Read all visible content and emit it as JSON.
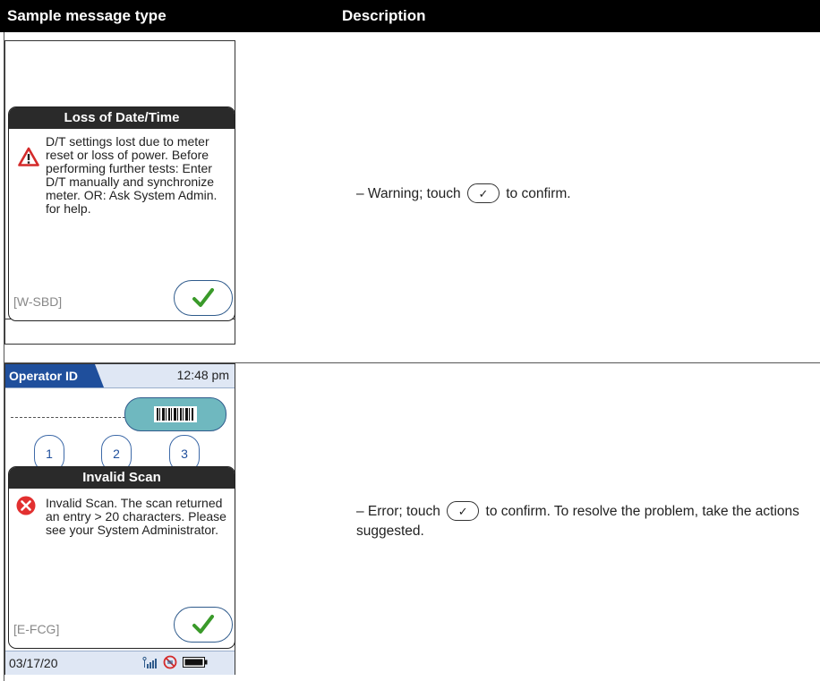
{
  "table": {
    "col1_header": "Sample message type",
    "col2_header": "Description"
  },
  "row1": {
    "dialog_title": "Loss of Date/Time",
    "message": "D/T settings lost due to meter reset or loss of power. Before performing further tests: Enter D/T manually and synchronize meter. OR: Ask System Admin. for help.",
    "code": "[W-SBD]",
    "icon": "warning-triangle-icon",
    "desc_before": "– Warning; touch",
    "desc_after": "to confirm."
  },
  "row2": {
    "header_title": "Operator ID",
    "time": "12:48 pm",
    "keys": [
      "1",
      "2",
      "3"
    ],
    "dialog_title": "Invalid Scan",
    "message": "Invalid Scan. The scan returned an entry > 20 characters. Please see your System Administrator.",
    "code": "[E-FCG]",
    "icon": "error-x-icon",
    "date": "03/17/20",
    "desc_before": "– Error; touch",
    "desc_after": "to confirm. To resolve the problem, take the actions suggested."
  },
  "colors": {
    "accent_blue": "#1f4f9c",
    "check_green": "#3a9a2a",
    "scan_teal": "#6fb8bf",
    "warning_red": "#d42a2a"
  },
  "glyphs": {
    "check": "✓",
    "bars": "📶"
  }
}
